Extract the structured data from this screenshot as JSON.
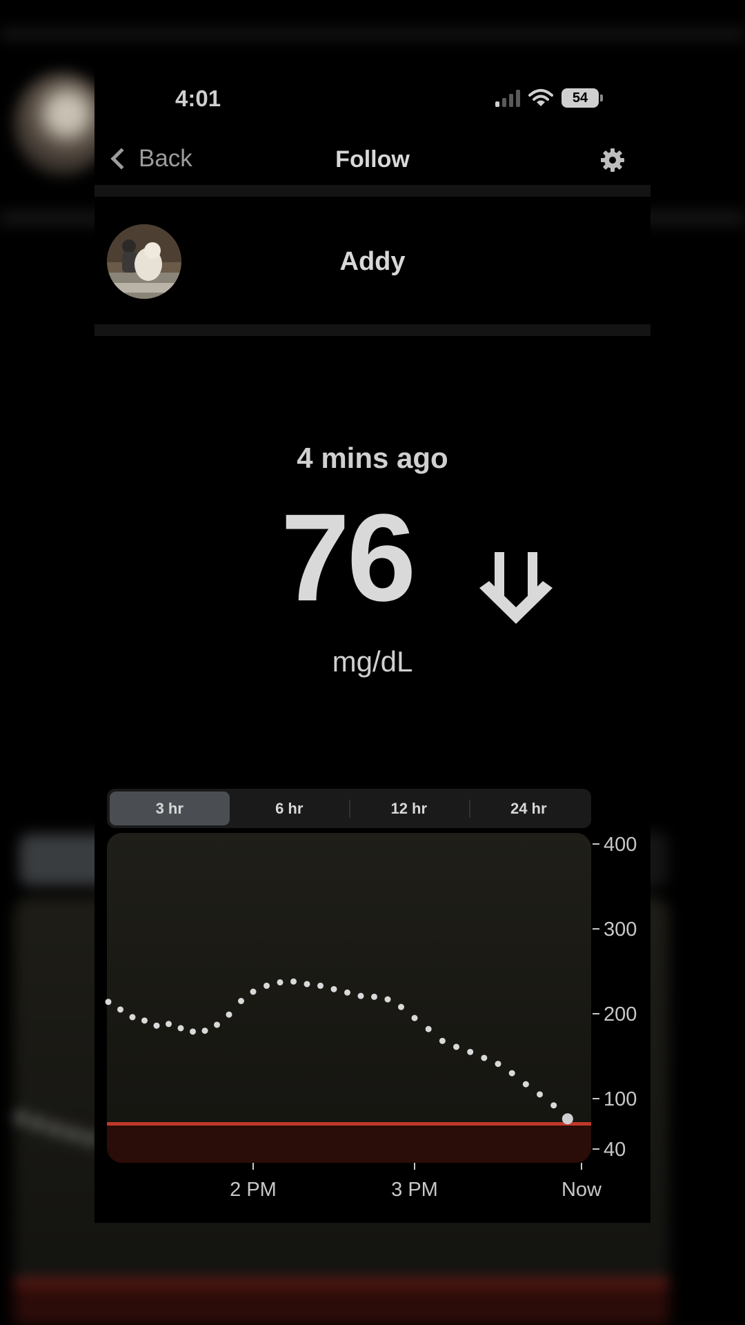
{
  "status_bar": {
    "time": "4:01",
    "battery": "54"
  },
  "nav": {
    "back_label": "Back",
    "title": "Follow"
  },
  "profile": {
    "name": "Addy"
  },
  "reading": {
    "time_ago": "4 mins ago",
    "value": "76",
    "unit": "mg/dL",
    "trend": "double-down-arrow"
  },
  "range_tabs": [
    {
      "label": "3 hr",
      "selected": true
    },
    {
      "label": "6 hr",
      "selected": false
    },
    {
      "label": "12 hr",
      "selected": false
    },
    {
      "label": "24 hr",
      "selected": false
    }
  ],
  "colors": {
    "low_line": "#c0392b",
    "low_band": "#2a0c09",
    "chart_bg": "#1c1b16",
    "dots": "#d9d9d9"
  },
  "chart_data": {
    "type": "scatter",
    "x_unit": "minutes before now",
    "xlim": [
      -180,
      0
    ],
    "x_ticks": [
      {
        "label": "2 PM",
        "value": -120
      },
      {
        "label": "3 PM",
        "value": -60
      },
      {
        "label": "Now",
        "value": 0
      }
    ],
    "ylim": [
      40,
      400
    ],
    "y_ticks": [
      400,
      300,
      200,
      100,
      40
    ],
    "low_threshold": 70,
    "series": [
      {
        "values": [
          {
            "x": -180,
            "y": 214
          },
          {
            "x": -175,
            "y": 205
          },
          {
            "x": -170,
            "y": 196
          },
          {
            "x": -165,
            "y": 192
          },
          {
            "x": -160,
            "y": 186
          },
          {
            "x": -155,
            "y": 188
          },
          {
            "x": -150,
            "y": 183
          },
          {
            "x": -145,
            "y": 179
          },
          {
            "x": -140,
            "y": 180
          },
          {
            "x": -135,
            "y": 187
          },
          {
            "x": -130,
            "y": 199
          },
          {
            "x": -125,
            "y": 215
          },
          {
            "x": -120,
            "y": 226
          },
          {
            "x": -115,
            "y": 233
          },
          {
            "x": -110,
            "y": 237
          },
          {
            "x": -105,
            "y": 238
          },
          {
            "x": -100,
            "y": 235
          },
          {
            "x": -95,
            "y": 233
          },
          {
            "x": -90,
            "y": 229
          },
          {
            "x": -85,
            "y": 225
          },
          {
            "x": -80,
            "y": 221
          },
          {
            "x": -75,
            "y": 220
          },
          {
            "x": -70,
            "y": 217
          },
          {
            "x": -65,
            "y": 208
          },
          {
            "x": -60,
            "y": 195
          },
          {
            "x": -55,
            "y": 182
          },
          {
            "x": -50,
            "y": 168
          },
          {
            "x": -45,
            "y": 161
          },
          {
            "x": -40,
            "y": 155
          },
          {
            "x": -35,
            "y": 148
          },
          {
            "x": -30,
            "y": 141
          },
          {
            "x": -25,
            "y": 130
          },
          {
            "x": -20,
            "y": 117
          },
          {
            "x": -15,
            "y": 105
          },
          {
            "x": -10,
            "y": 92
          },
          {
            "x": -5,
            "y": 76
          }
        ]
      }
    ]
  }
}
